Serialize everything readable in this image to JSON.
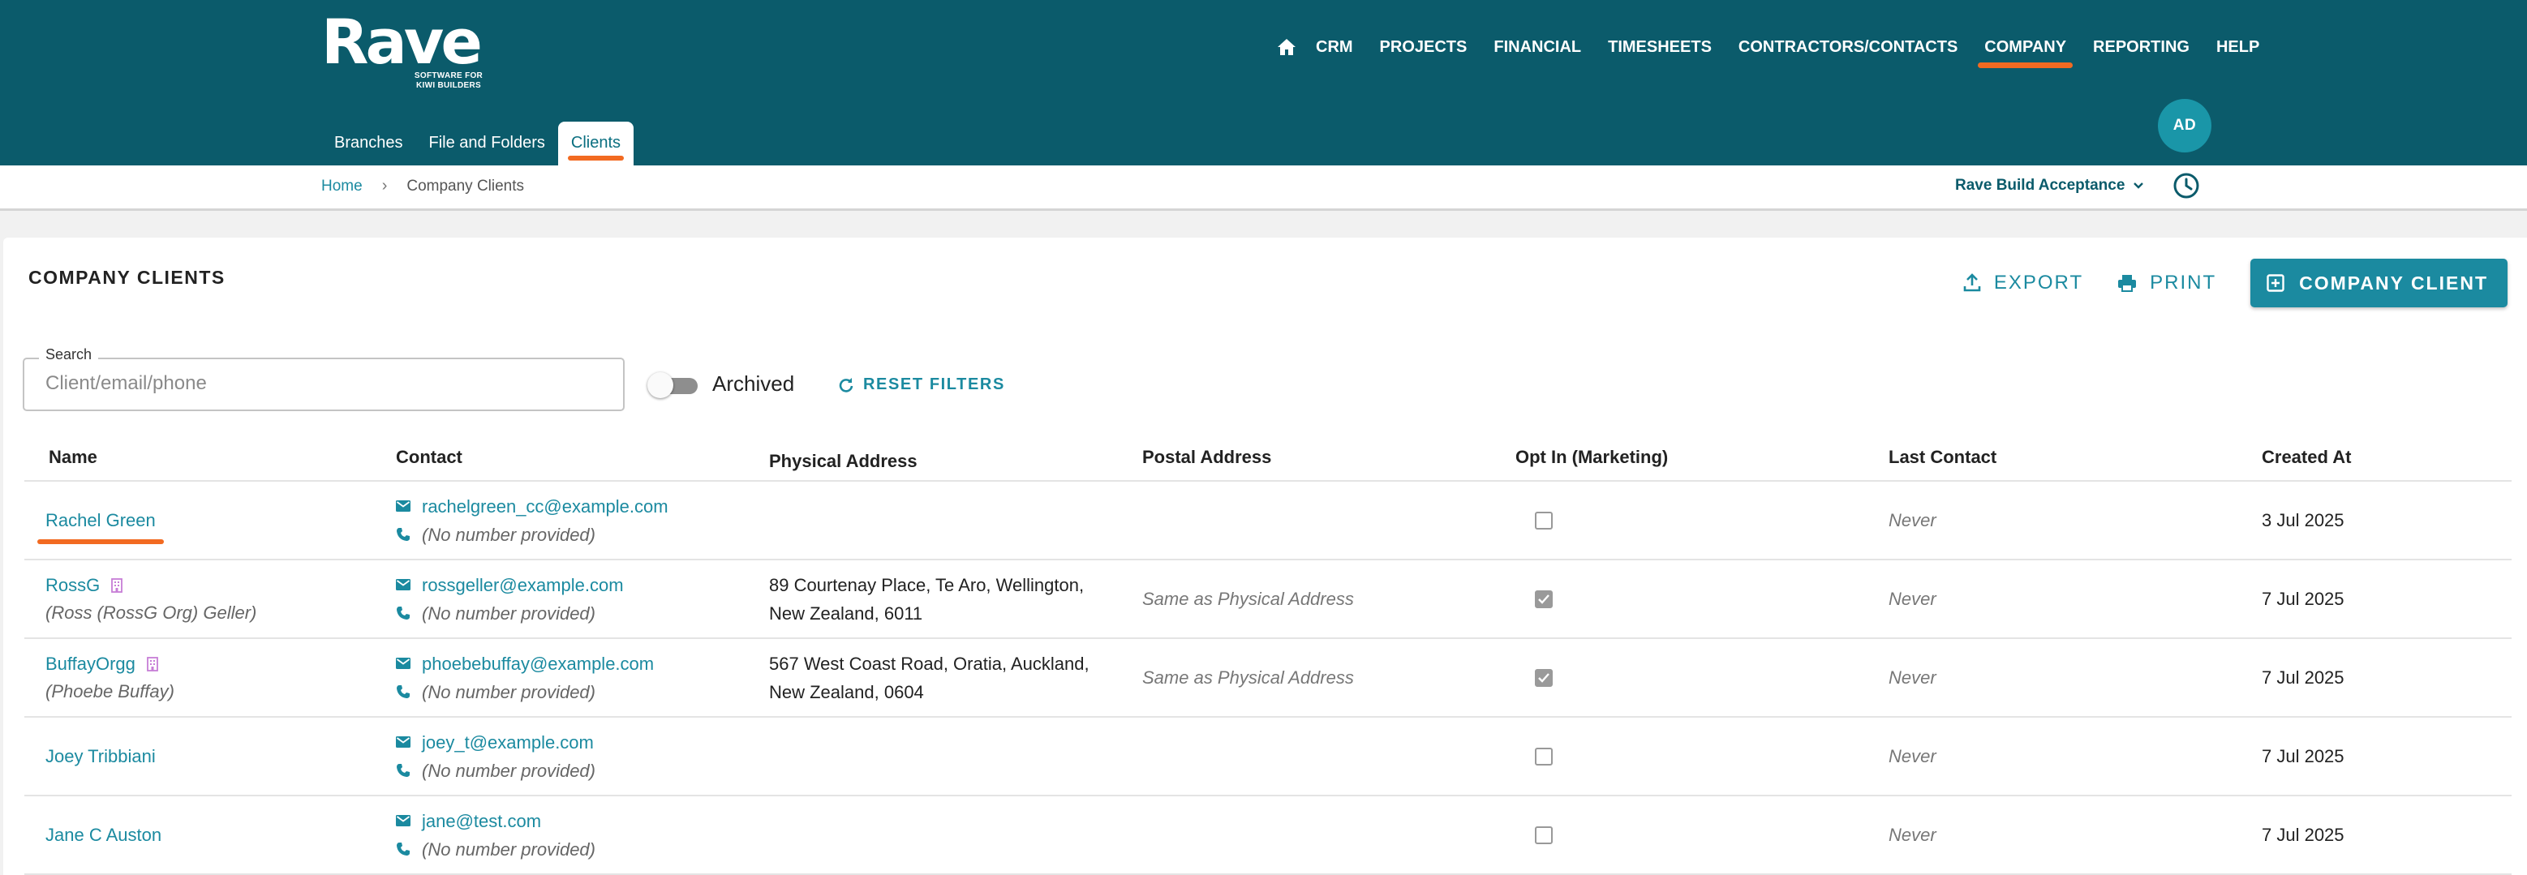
{
  "app": {
    "logo_word": "Rave",
    "logo_tagline": "SOFTWARE FOR KIWI BUILDERS"
  },
  "nav": {
    "items": [
      "CRM",
      "PROJECTS",
      "FINANCIAL",
      "TIMESHEETS",
      "CONTRACTORS/CONTACTS",
      "COMPANY",
      "REPORTING",
      "HELP"
    ],
    "active": "COMPANY"
  },
  "user": {
    "initials": "AD"
  },
  "subtabs": {
    "items": [
      "Branches",
      "File and Folders",
      "Clients"
    ],
    "active": "Clients"
  },
  "breadcrumb": {
    "home": "Home",
    "current": "Company Clients"
  },
  "company_selector": {
    "value": "Rave Build Acceptance"
  },
  "page": {
    "title": "COMPANY CLIENTS",
    "export_label": "EXPORT",
    "print_label": "PRINT",
    "add_label": "COMPANY CLIENT"
  },
  "filters": {
    "search_label": "Search",
    "search_placeholder": "Client/email/phone",
    "search_value": "",
    "archived_label": "Archived",
    "archived_on": false,
    "reset_label": "RESET FILTERS"
  },
  "table": {
    "columns": [
      "Name",
      "Contact",
      "Physical Address",
      "Postal Address",
      "Opt In (Marketing)",
      "Last Contact",
      "Created At"
    ],
    "rows": [
      {
        "name": "Rachel Green",
        "sub_name": "",
        "is_org": false,
        "email": "rachelgreen_cc@example.com",
        "phone": "(No number provided)",
        "physical_address": [
          "",
          ""
        ],
        "postal_address": "",
        "opt_in": false,
        "last_contact": "Never",
        "created_at": "3 Jul 2025"
      },
      {
        "name": "RossG",
        "sub_name": "(Ross (RossG Org) Geller)",
        "is_org": true,
        "email": "rossgeller@example.com",
        "phone": "(No number provided)",
        "physical_address": [
          "89 Courtenay Place, Te Aro, Wellington,",
          "New Zealand, 6011"
        ],
        "postal_address": "Same as Physical Address",
        "opt_in": true,
        "last_contact": "Never",
        "created_at": "7 Jul 2025"
      },
      {
        "name": "BuffayOrgg",
        "sub_name": "(Phoebe Buffay)",
        "is_org": true,
        "email": "phoebebuffay@example.com",
        "phone": "(No number provided)",
        "physical_address": [
          "567 West Coast Road, Oratia, Auckland,",
          "New Zealand, 0604"
        ],
        "postal_address": "Same as Physical Address",
        "opt_in": true,
        "last_contact": "Never",
        "created_at": "7 Jul 2025"
      },
      {
        "name": "Joey Tribbiani",
        "sub_name": "",
        "is_org": false,
        "email": "joey_t@example.com",
        "phone": "(No number provided)",
        "physical_address": [
          "",
          ""
        ],
        "postal_address": "",
        "opt_in": false,
        "last_contact": "Never",
        "created_at": "7 Jul 2025"
      },
      {
        "name": "Jane C Auston",
        "sub_name": "",
        "is_org": false,
        "email": "jane@test.com",
        "phone": "(No number provided)",
        "physical_address": [
          "",
          ""
        ],
        "postal_address": "",
        "opt_in": false,
        "last_contact": "Never",
        "created_at": "7 Jul 2025"
      }
    ]
  },
  "colors": {
    "header_bg": "#0b5b6b",
    "accent": "#1b8aa0",
    "active_underline": "#f26a21",
    "org_icon": "#c77dd6"
  }
}
